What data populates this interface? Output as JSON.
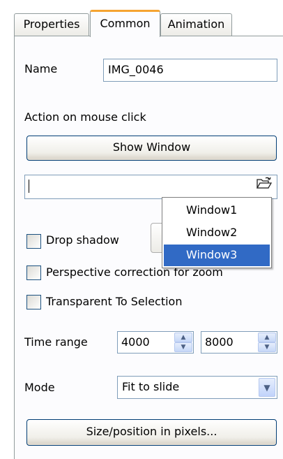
{
  "tabs": [
    {
      "label": "Properties",
      "active": false
    },
    {
      "label": "Common",
      "active": true
    },
    {
      "label": "Animation",
      "active": false
    }
  ],
  "name_field": {
    "label": "Name",
    "value": "IMG_0046"
  },
  "action": {
    "label": "Action on mouse click",
    "button_label": "Show Window",
    "target_value": "",
    "folder_icon": "folder-open-icon"
  },
  "window_list": {
    "items": [
      "Window1",
      "Window2",
      "Window3"
    ],
    "selected": "Window3"
  },
  "checkboxes": {
    "drop_shadow": {
      "label": "Drop shadow",
      "checked": false
    },
    "perspective": {
      "label": "Perspective correction for zoom",
      "checked": false
    },
    "transparent": {
      "label": "Transparent To Selection",
      "checked": false
    }
  },
  "time_range": {
    "label": "Time range",
    "start": "4000",
    "end": "8000"
  },
  "mode": {
    "label": "Mode",
    "value": "Fit to slide"
  },
  "size_button_label": "Size/position in pixels...",
  "colors": {
    "active_tab_accent": "#f5a431",
    "selection": "#316ac5",
    "button_border": "#003c74",
    "field_border": "#7f9db9"
  }
}
